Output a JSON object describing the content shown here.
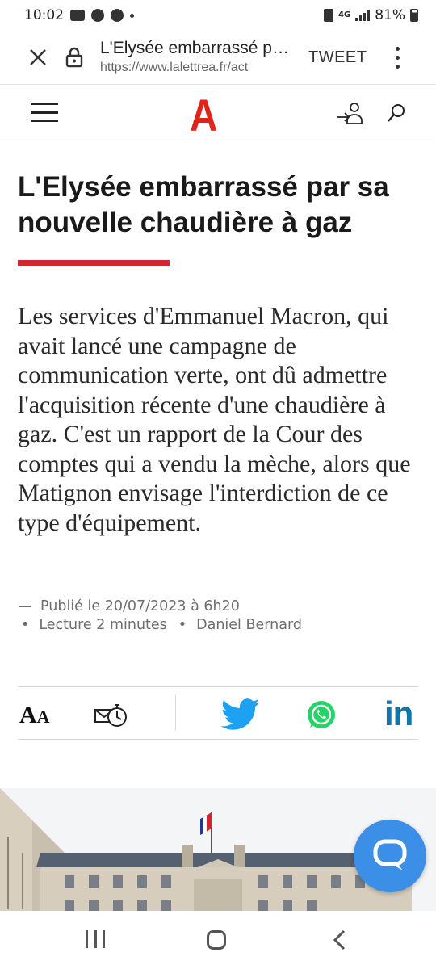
{
  "status_bar": {
    "time": "10:02",
    "network": "4G",
    "battery": "81%"
  },
  "browser": {
    "tab_title": "L'Elysée embarrassé par sa nouvelle chaudière à gaz",
    "url": "https://www.lalettrea.fr/act",
    "tweet_label": "TWEET",
    "icons": [
      "close-icon",
      "lock-icon",
      "more-vert-icon"
    ]
  },
  "site": {
    "logo": "A",
    "icons": [
      "menu-icon",
      "login-icon",
      "search-icon"
    ],
    "brand_color": "#e2231a"
  },
  "article": {
    "headline": "L'Elysée embarrassé par sa nouvelle chaudière à gaz",
    "lead": "Les services d'Emmanuel Macron, qui avait lancé une campagne de communication verte, ont dû admettre l'acquisition récente d'une chaudière à gaz. C'est un rapport de la Cour des comptes qui a vendu la mèche, alors que Matignon envisage l'interdiction de ce type d'équipement.",
    "published": "Publié le 20/07/2023 à 6h20",
    "reading_time": "Lecture 2 minutes",
    "author": "Daniel Bernard",
    "accent_color": "#d0282e"
  },
  "share": {
    "font_size_label_big": "A",
    "font_size_label_small": "A",
    "icons": [
      "font-size-icon",
      "send-later-icon",
      "twitter-icon",
      "whatsapp-icon",
      "linkedin-icon"
    ],
    "linkedin_label": "in",
    "twitter_color": "#1da1f2",
    "whatsapp_color": "#25d366",
    "linkedin_color": "#0e76a8"
  },
  "chat": {
    "icon": "chat-icon",
    "color": "#3b8fe6"
  },
  "nav_bar": {
    "icons": [
      "recents-icon",
      "home-icon",
      "back-icon"
    ]
  }
}
